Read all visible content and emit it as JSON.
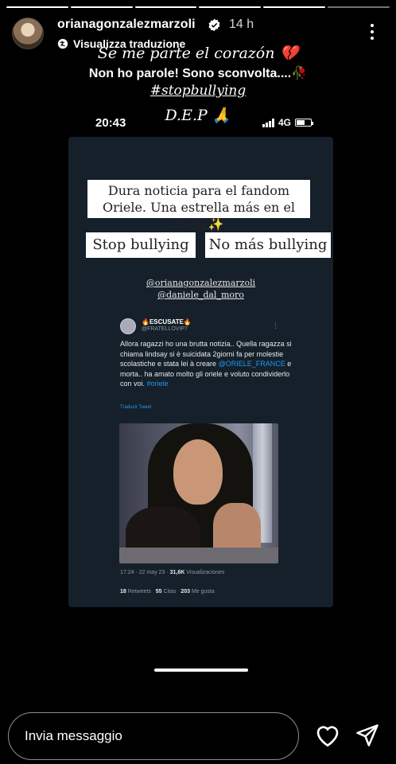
{
  "story": {
    "progress_segments": 6,
    "username": "orianagonzalezmarzoli",
    "time_ago": "14 h",
    "translate_label": "Visualizza traduzione",
    "captions": {
      "line1": "Se me parte el corazón 💔",
      "line2": "Non ho parole! Sono sconvolta....🥀",
      "line3": "#stopbullying",
      "line4": "D.E.P 🙏"
    }
  },
  "phone_status": {
    "time": "20:43",
    "network": "4G"
  },
  "card": {
    "headline": "Dura noticia para el fandom Oriele. Una estrella más en el cielo ✨",
    "tag1": "Stop bullying",
    "tag2": "No más bullying",
    "mentions": [
      "@orianagonzalezmarzoli",
      "@daniele_dal_moro"
    ]
  },
  "tweet": {
    "name": "🔥ESCUSATE🔥",
    "handle": "@FRATELLOVIP7",
    "body_start": "Allora ragazzi ho una brutta notizia.. Quella ragazza si chiama lindsay si è suicidata 2giorni fa per molestie scolastiche e stata lei à creare ",
    "mention": "@ORIELE_FRANCE",
    "body_mid": " e morta.. ha amato molto gli oriele e voluto condividerlo con voi. ",
    "hashtag": "#oriele",
    "translate": "Traducir Tweet",
    "datetime": "17:24 · 22 may 23 · ",
    "views_count": "31,6K",
    "views_label": " Visualizaciones",
    "retweets_count": "18",
    "retweets_label": " Retweets",
    "quotes_count": "55",
    "quotes_label": " Citas",
    "likes_count": "203",
    "likes_label": " Me gusta"
  },
  "footer": {
    "message_placeholder": "Invia messaggio"
  },
  "colors": {
    "background": "#000000",
    "card": "#15202b",
    "link": "#1d9bf0",
    "verified": "#ffffff"
  },
  "icons": [
    "verified-badge-icon",
    "more-options-icon",
    "translate-icon",
    "signal-icon",
    "battery-icon",
    "heart-icon",
    "send-icon"
  ]
}
